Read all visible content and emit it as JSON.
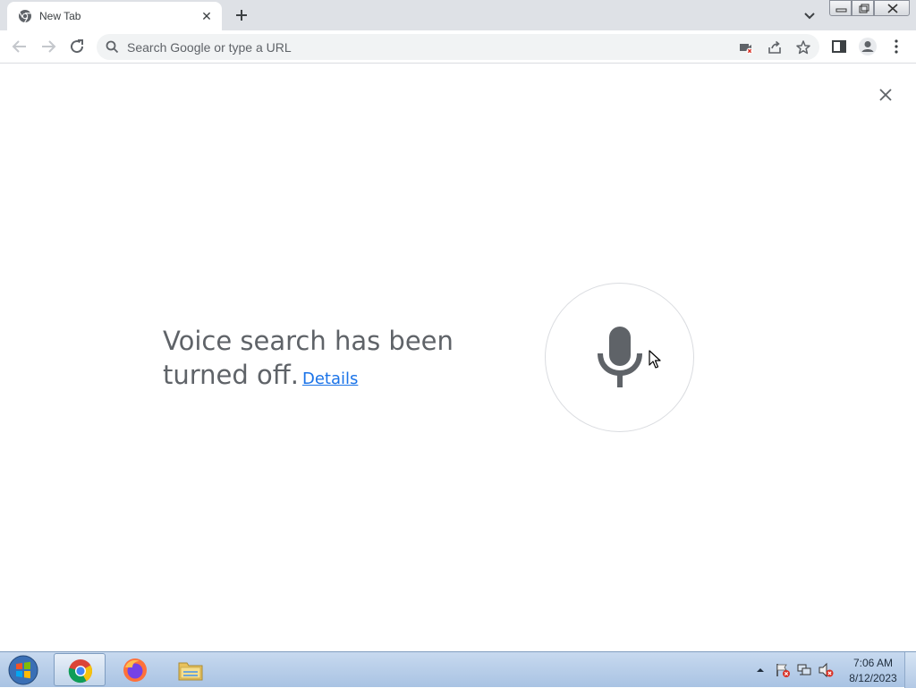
{
  "browser": {
    "tab": {
      "title": "New Tab"
    },
    "omnibox": {
      "placeholder": "Search Google or type a URL"
    },
    "accent_color": "#1a73e8"
  },
  "voice_search": {
    "message": "Voice search has been turned off.",
    "details_link": "Details"
  },
  "taskbar": {
    "items": [
      "chrome-icon",
      "firefox-icon",
      "file-explorer-icon"
    ],
    "clock": {
      "time": "7:06 AM",
      "date": "8/12/2023"
    }
  }
}
